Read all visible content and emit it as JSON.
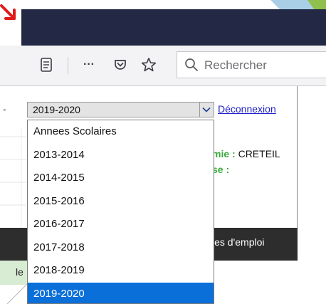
{
  "toolbar": {
    "icons": [
      "reader-view-icon",
      "more-icon",
      "pocket-icon",
      "star-icon",
      "search-icon"
    ],
    "more_label": "···",
    "search_placeholder": "Rechercher"
  },
  "page": {
    "dash": "-",
    "select": {
      "value": "2019-2020"
    },
    "logout_label": "Déconnexion",
    "info": [
      {
        "label": "mie : ",
        "value": "CRETEIL"
      },
      {
        "label": "se :",
        "value": ""
      }
    ],
    "menu_item": "les d'emploi",
    "green_strip_text": "le"
  },
  "dropdown": {
    "options": [
      {
        "label": "Annees Scolaires",
        "selected": false
      },
      {
        "label": "2013-2014",
        "selected": false
      },
      {
        "label": "2014-2015",
        "selected": false
      },
      {
        "label": "2015-2016",
        "selected": false
      },
      {
        "label": "2016-2017",
        "selected": false
      },
      {
        "label": "2017-2018",
        "selected": false
      },
      {
        "label": "2018-2019",
        "selected": false
      },
      {
        "label": "2019-2020",
        "selected": true
      }
    ]
  },
  "colors": {
    "title_bar": "#232844",
    "selected_option": "#0a6fd8",
    "link": "#2020c8",
    "info_label": "#3aa83a",
    "menu_bar": "#2d2d2d"
  }
}
